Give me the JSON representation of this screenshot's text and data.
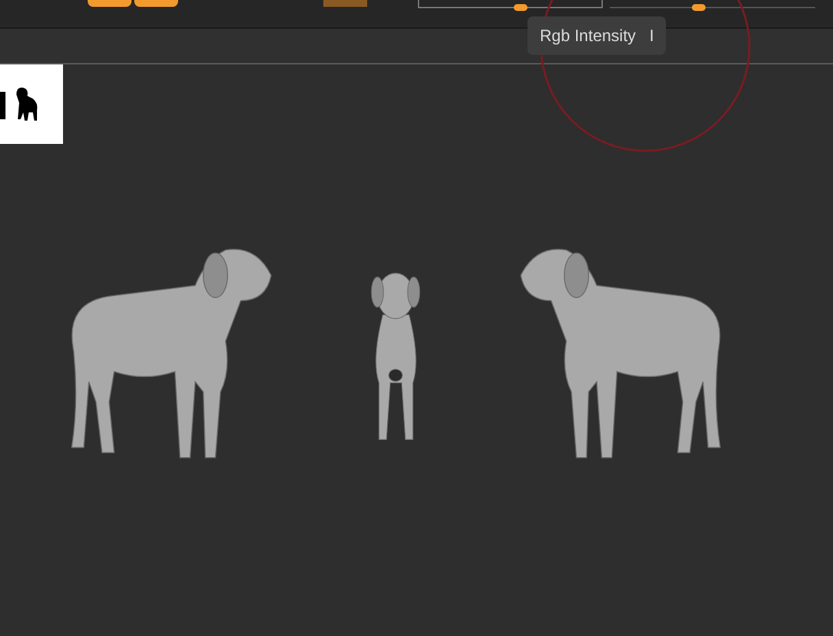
{
  "toolbar": {
    "sliders": [
      {
        "level": 0.56
      },
      {
        "level": 0.43
      }
    ]
  },
  "tooltip": {
    "label": "Rgb Intensity",
    "shortcut": "I"
  },
  "viewport": {
    "models": [
      {
        "kind": "side"
      },
      {
        "kind": "front"
      },
      {
        "kind": "mirrored"
      }
    ]
  }
}
